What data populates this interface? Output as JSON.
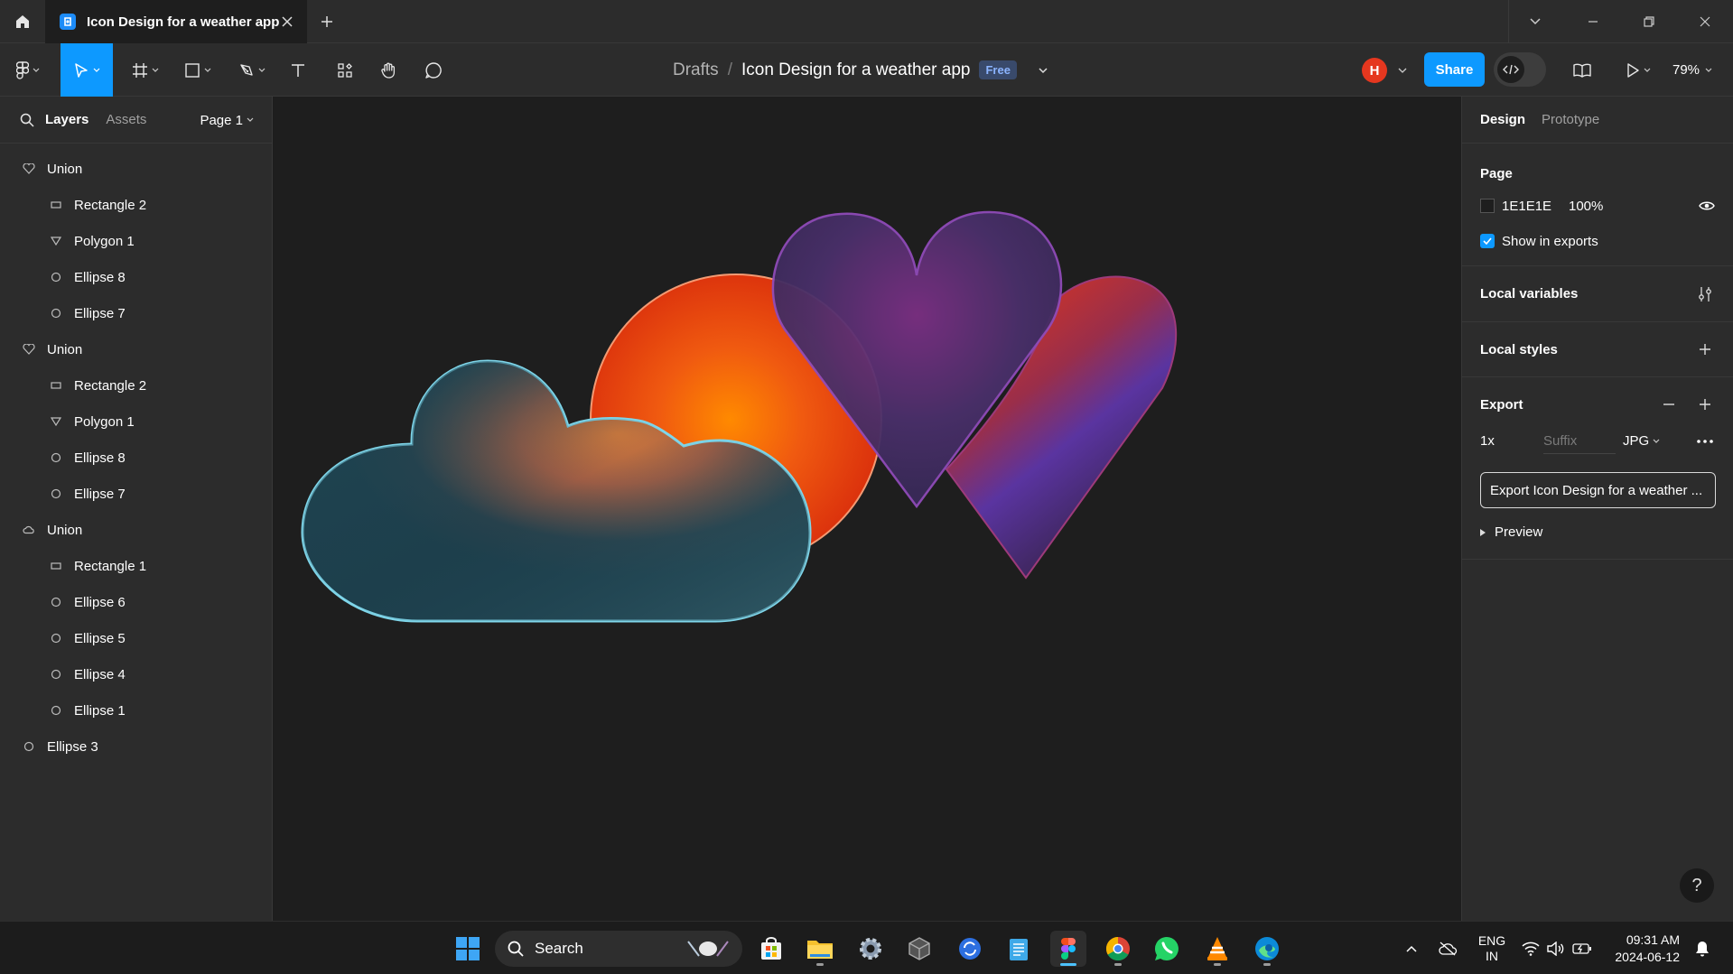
{
  "browser": {
    "tab_title": "Icon Design for a weather app"
  },
  "toolbar": {
    "breadcrumb_drafts": "Drafts",
    "breadcrumb_sep": "/",
    "file_name": "Icon Design for a weather app",
    "plan_badge": "Free",
    "avatar_initial": "H",
    "share_label": "Share",
    "zoom": "79%"
  },
  "left_panel": {
    "tabs": [
      "Layers",
      "Assets"
    ],
    "page": "Page 1",
    "layers": [
      {
        "name": "Union",
        "icon": "heart-icon",
        "level": 0
      },
      {
        "name": "Rectangle 2",
        "icon": "rectangle-icon",
        "level": 1
      },
      {
        "name": "Polygon 1",
        "icon": "triangle-icon",
        "level": 1
      },
      {
        "name": "Ellipse 8",
        "icon": "ellipse-icon",
        "level": 1
      },
      {
        "name": "Ellipse 7",
        "icon": "ellipse-icon",
        "level": 1
      },
      {
        "name": "Union",
        "icon": "heart-icon",
        "level": 0
      },
      {
        "name": "Rectangle 2",
        "icon": "rectangle-icon",
        "level": 1
      },
      {
        "name": "Polygon 1",
        "icon": "triangle-icon",
        "level": 1
      },
      {
        "name": "Ellipse 8",
        "icon": "ellipse-icon",
        "level": 1
      },
      {
        "name": "Ellipse 7",
        "icon": "ellipse-icon",
        "level": 1
      },
      {
        "name": "Union",
        "icon": "cloud-icon",
        "level": 0
      },
      {
        "name": "Rectangle 1",
        "icon": "rectangle-icon",
        "level": 1
      },
      {
        "name": "Ellipse 6",
        "icon": "ellipse-icon",
        "level": 1
      },
      {
        "name": "Ellipse 5",
        "icon": "ellipse-icon",
        "level": 1
      },
      {
        "name": "Ellipse 4",
        "icon": "ellipse-icon",
        "level": 1
      },
      {
        "name": "Ellipse 1",
        "icon": "ellipse-icon",
        "level": 1
      },
      {
        "name": "Ellipse 3",
        "icon": "ellipse-icon",
        "level": 0
      }
    ]
  },
  "right_panel": {
    "tabs": [
      "Design",
      "Prototype"
    ],
    "page_heading": "Page",
    "page_color": "1E1E1E",
    "page_color_hex": "#1e1e1e",
    "page_opacity": "100%",
    "show_in_exports": "Show in exports",
    "local_variables": "Local variables",
    "local_styles": "Local styles",
    "export_heading": "Export",
    "export_scale": "1x",
    "export_suffix_placeholder": "Suffix",
    "export_format": "JPG",
    "export_button": "Export Icon Design for a weather ...",
    "preview": "Preview",
    "help": "?"
  },
  "taskbar": {
    "search_placeholder": "Search",
    "lang_1": "ENG",
    "lang_2": "IN",
    "time": "09:31 AM",
    "date": "2024-06-12"
  },
  "colors": {
    "accent": "#0d99ff",
    "panel_bg": "#2c2c2c",
    "canvas_bg": "#1e1e1e",
    "avatar": "#e5371f"
  }
}
